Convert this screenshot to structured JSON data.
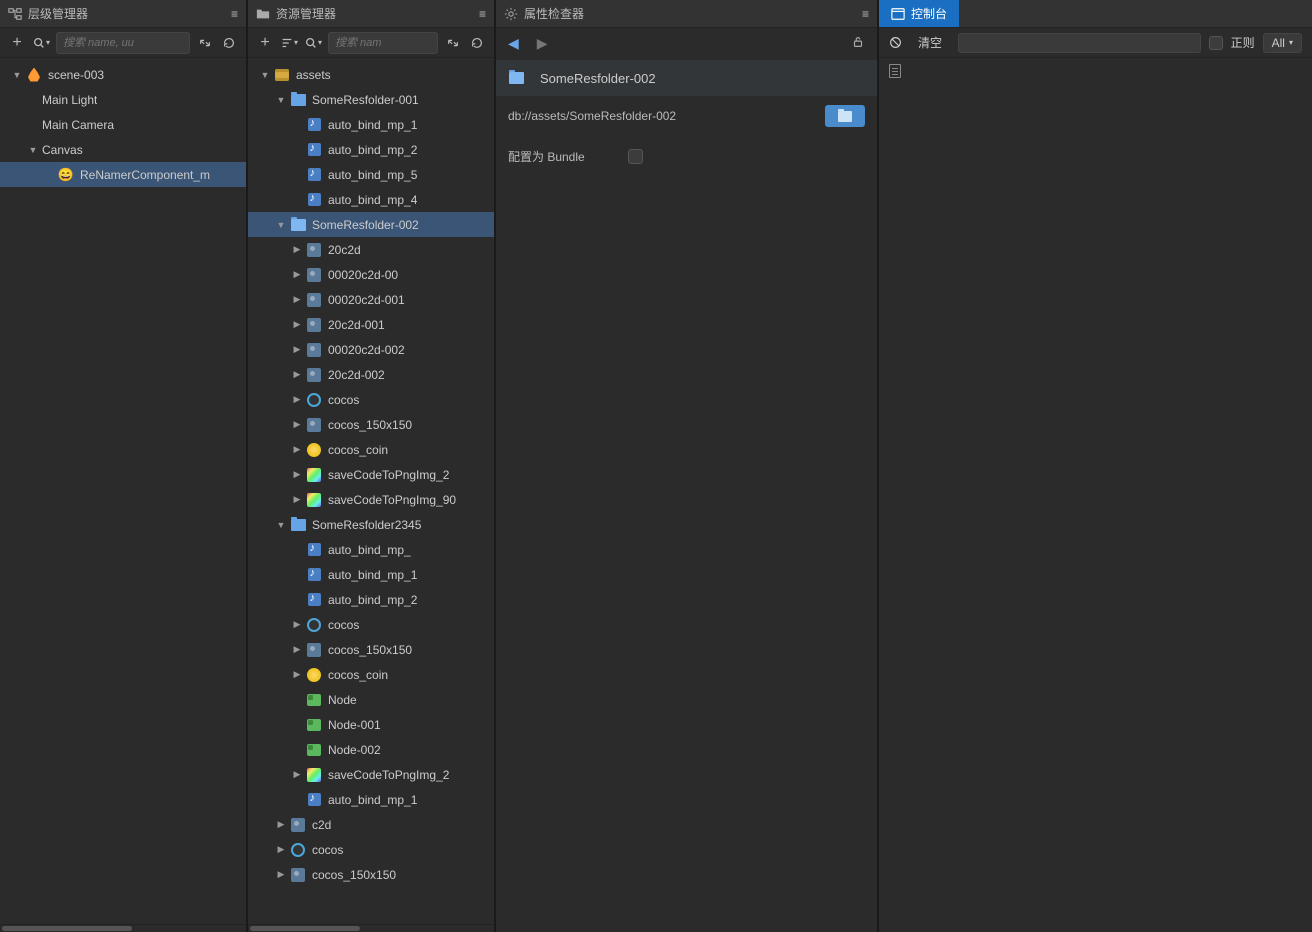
{
  "hierarchy": {
    "title": "层级管理器",
    "search_placeholder": "搜索 name, uu",
    "tree": [
      {
        "depth": 0,
        "arrow": "down",
        "icon": "scene-fire",
        "label": "scene-003"
      },
      {
        "depth": 1,
        "arrow": "none",
        "icon": "",
        "label": "Main Light"
      },
      {
        "depth": 1,
        "arrow": "none",
        "icon": "",
        "label": "Main Camera"
      },
      {
        "depth": 1,
        "arrow": "down",
        "icon": "",
        "label": "Canvas"
      },
      {
        "depth": 2,
        "arrow": "none",
        "icon": "emoji",
        "emoji": "😄",
        "label": "ReNamerComponent_m",
        "selected": true
      }
    ]
  },
  "assets": {
    "title": "资源管理器",
    "search_placeholder": "搜索 nam",
    "tree": [
      {
        "depth": 0,
        "arrow": "down",
        "icon": "db",
        "label": "assets"
      },
      {
        "depth": 1,
        "arrow": "down",
        "icon": "folder",
        "label": "SomeResfolder-001"
      },
      {
        "depth": 2,
        "arrow": "none",
        "icon": "audio",
        "label": "auto_bind_mp_1"
      },
      {
        "depth": 2,
        "arrow": "none",
        "icon": "audio",
        "label": "auto_bind_mp_2"
      },
      {
        "depth": 2,
        "arrow": "none",
        "icon": "audio",
        "label": "auto_bind_mp_5"
      },
      {
        "depth": 2,
        "arrow": "none",
        "icon": "audio",
        "label": "auto_bind_mp_4"
      },
      {
        "depth": 1,
        "arrow": "down",
        "icon": "folder-open",
        "label": "SomeResfolder-002",
        "selected": true
      },
      {
        "depth": 2,
        "arrow": "right",
        "icon": "img",
        "label": "20c2d"
      },
      {
        "depth": 2,
        "arrow": "right",
        "icon": "img",
        "label": "00020c2d-00"
      },
      {
        "depth": 2,
        "arrow": "right",
        "icon": "img",
        "label": "00020c2d-001"
      },
      {
        "depth": 2,
        "arrow": "right",
        "icon": "img",
        "label": "20c2d-001"
      },
      {
        "depth": 2,
        "arrow": "right",
        "icon": "img",
        "label": "00020c2d-002"
      },
      {
        "depth": 2,
        "arrow": "right",
        "icon": "img",
        "label": "20c2d-002"
      },
      {
        "depth": 2,
        "arrow": "right",
        "icon": "cocos",
        "label": "cocos"
      },
      {
        "depth": 2,
        "arrow": "right",
        "icon": "img",
        "label": "cocos_150x150"
      },
      {
        "depth": 2,
        "arrow": "right",
        "icon": "coin",
        "label": "cocos_coin"
      },
      {
        "depth": 2,
        "arrow": "right",
        "icon": "rainbow",
        "label": "saveCodeToPngImg_2"
      },
      {
        "depth": 2,
        "arrow": "right",
        "icon": "rainbow",
        "label": "saveCodeToPngImg_90"
      },
      {
        "depth": 1,
        "arrow": "down",
        "icon": "folder",
        "label": "SomeResfolder2345"
      },
      {
        "depth": 2,
        "arrow": "none",
        "icon": "audio",
        "label": "auto_bind_mp_"
      },
      {
        "depth": 2,
        "arrow": "none",
        "icon": "audio",
        "label": "auto_bind_mp_1"
      },
      {
        "depth": 2,
        "arrow": "none",
        "icon": "audio",
        "label": "auto_bind_mp_2"
      },
      {
        "depth": 2,
        "arrow": "right",
        "icon": "cocos",
        "label": "cocos"
      },
      {
        "depth": 2,
        "arrow": "right",
        "icon": "img",
        "label": "cocos_150x150"
      },
      {
        "depth": 2,
        "arrow": "right",
        "icon": "coin",
        "label": "cocos_coin"
      },
      {
        "depth": 2,
        "arrow": "none",
        "icon": "prefab",
        "label": "Node"
      },
      {
        "depth": 2,
        "arrow": "none",
        "icon": "prefab",
        "label": "Node-001"
      },
      {
        "depth": 2,
        "arrow": "none",
        "icon": "prefab",
        "label": "Node-002"
      },
      {
        "depth": 2,
        "arrow": "right",
        "icon": "rainbow",
        "label": "saveCodeToPngImg_2"
      },
      {
        "depth": 2,
        "arrow": "none",
        "icon": "audio",
        "label": "auto_bind_mp_1"
      },
      {
        "depth": 1,
        "arrow": "right",
        "icon": "img",
        "label": "c2d"
      },
      {
        "depth": 1,
        "arrow": "right",
        "icon": "cocos",
        "label": "cocos"
      },
      {
        "depth": 1,
        "arrow": "right",
        "icon": "img",
        "label": "cocos_150x150"
      }
    ]
  },
  "inspector": {
    "title": "属性检查器",
    "folder_name": "SomeResfolder-002",
    "path": "db://assets/SomeResfolder-002",
    "bundle_label": "配置为 Bundle"
  },
  "console": {
    "tab": "控制台",
    "clear": "清空",
    "regex": "正则",
    "filter": "All"
  }
}
